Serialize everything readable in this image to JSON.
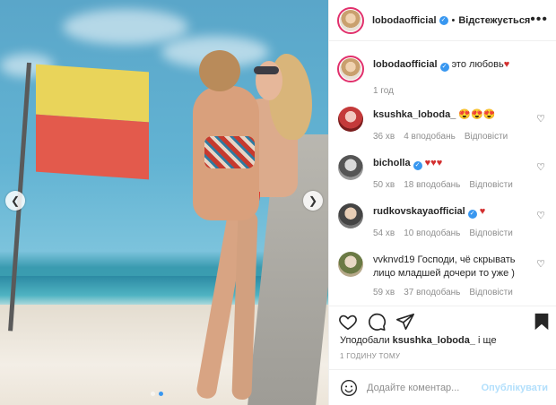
{
  "header": {
    "username": "lobodaofficial",
    "separator": "•",
    "follow_label": "Відстежується",
    "more_label": "•••"
  },
  "caption": {
    "username": "lobodaofficial",
    "text": "это любовь",
    "emoji": "♥",
    "time": "1 год"
  },
  "comments": [
    {
      "username": "ksushka_loboda_",
      "text": "😍😍😍",
      "time": "36 хв",
      "likes": "4 вподобань",
      "reply": "Відповісти"
    },
    {
      "username": "bicholla",
      "text": "♥♥♥",
      "time": "50 хв",
      "likes": "18 вподобань",
      "reply": "Відповісти"
    },
    {
      "username": "rudkovskayaofficial",
      "text": "♥",
      "time": "54 хв",
      "likes": "10 вподобань",
      "reply": "Відповісти"
    },
    {
      "username": "vvknvd19",
      "text": "Господи, чё скрывать лицо младшей дочери то уже )",
      "time": "59 хв",
      "likes": "37 вподобань",
      "reply": "Відповісти"
    }
  ],
  "likes": {
    "prefix": "Уподобали",
    "user": "ksushka_loboda_",
    "suffix": "і ще"
  },
  "post_time": "1 годину тому",
  "add_comment": {
    "placeholder": "Додайте коментар...",
    "publish_label": "Опублікувати"
  },
  "colors": {
    "verified": "#3897f0",
    "story_ring": "#e1306c",
    "heart_red": "#d32f2f",
    "publish_disabled": "#b2dffc"
  },
  "carousel": {
    "slide_count": 2,
    "active_slide": 2
  }
}
